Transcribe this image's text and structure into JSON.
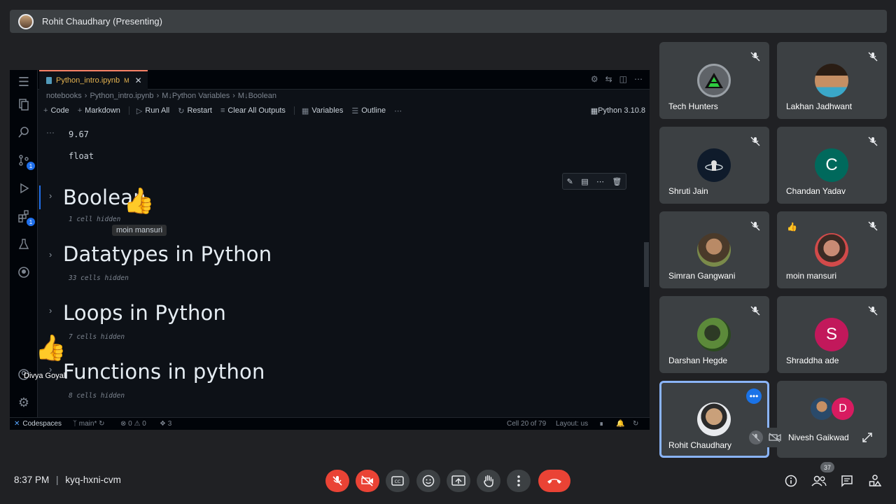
{
  "presenter_bar": {
    "title": "Rohit Chaudhary (Presenting)"
  },
  "editor": {
    "tab": {
      "filename": "Python_intro.ipynb",
      "modified": "M"
    },
    "breadcrumbs": [
      "notebooks",
      "Python_intro.ipynb",
      "M↓Python Variables",
      "M↓Boolean"
    ],
    "toolbar": {
      "code": "Code",
      "markdown": "Markdown",
      "run_all": "Run All",
      "restart": "Restart",
      "clear_outputs": "Clear All Outputs",
      "variables": "Variables",
      "outline": "Outline",
      "kernel": "Python 3.10.8"
    },
    "activity_badges": [
      "1",
      "1"
    ],
    "output_dots": "···",
    "outputs": [
      "9.67",
      "float"
    ],
    "sections": [
      {
        "title": "Boolean",
        "hidden": "1 cell hidden"
      },
      {
        "title": "Datatypes in Python",
        "hidden": "33 cells hidden"
      },
      {
        "title": "Loops in Python",
        "hidden": "7 cells hidden"
      },
      {
        "title": "Functions in python",
        "hidden": "8 cells hidden"
      }
    ],
    "reactions": [
      {
        "name": "moin mansuri",
        "emoji": "👍"
      },
      {
        "name": "Divya Goyal",
        "emoji": "👍"
      }
    ],
    "statusbar": {
      "remote": "Codespaces",
      "branch": "main*",
      "errors": "0",
      "warnings": "0",
      "ports": "3",
      "cell": "Cell 20 of 79",
      "layout": "Layout: us"
    }
  },
  "participants": [
    {
      "name": "Tech Hunters",
      "avatar": "logo",
      "muted": true
    },
    {
      "name": "Lakhan Jadhwant",
      "avatar": "photo",
      "muted": true
    },
    {
      "name": "Shruti Jain",
      "avatar": "logo",
      "muted": true
    },
    {
      "name": "Chandan Yadav",
      "avatar_letter": "C",
      "avatar_color": "#00695c",
      "muted": true
    },
    {
      "name": "Simran Gangwani",
      "avatar": "photo",
      "muted": true
    },
    {
      "name": "moin mansuri",
      "avatar": "photo",
      "muted": true,
      "reaction": "👍"
    },
    {
      "name": "Darshan Hegde",
      "avatar": "photo",
      "muted": true
    },
    {
      "name": "Shraddha ade",
      "avatar_letter": "S",
      "avatar_color": "#c2185b",
      "muted": true
    },
    {
      "name": "Rohit Chaudhary",
      "avatar": "photo",
      "active": true
    },
    {
      "name": "Nivesh Gaikwad",
      "avatar_letter": "D",
      "avatar_color": "#d81b60"
    }
  ],
  "bottom": {
    "time": "8:37 PM",
    "separator": "|",
    "meeting_code": "kyq-hxni-cvm",
    "participant_count": "37"
  },
  "colors": {
    "meet_bg": "#202124",
    "tile_bg": "#3c4043",
    "red": "#ea4335",
    "accent_blue": "#8ab4f8"
  }
}
